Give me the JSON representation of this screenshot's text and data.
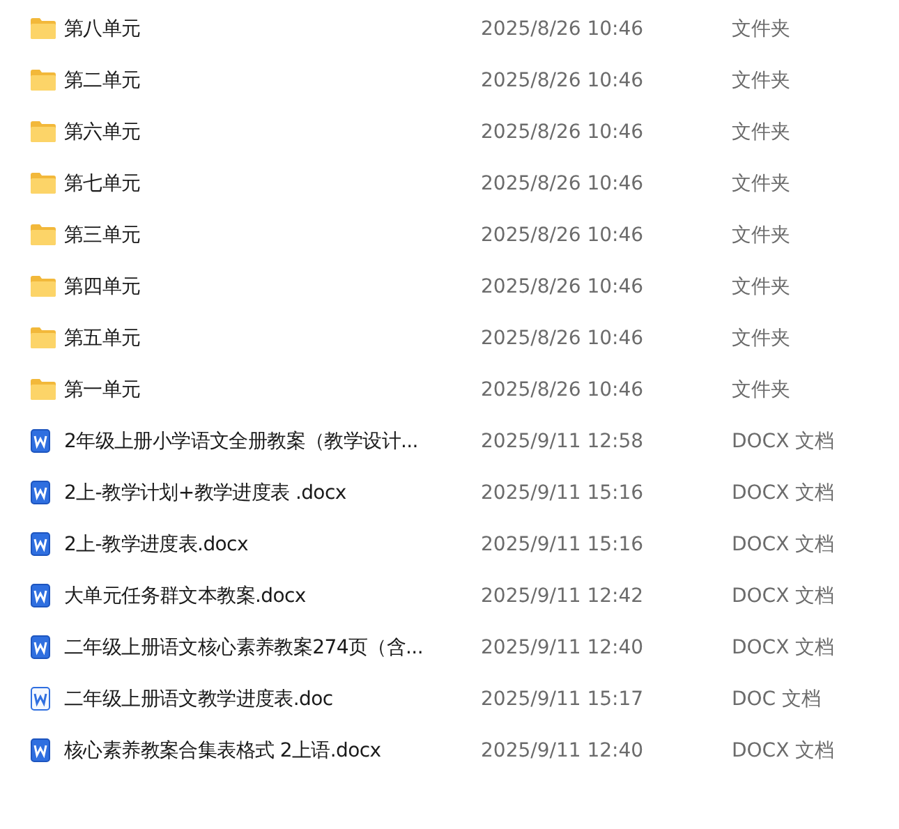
{
  "files": [
    {
      "kind": "folder",
      "name": "第八单元",
      "modified": "2025/8/26 10:46",
      "type": "文件夹"
    },
    {
      "kind": "folder",
      "name": "第二单元",
      "modified": "2025/8/26 10:46",
      "type": "文件夹"
    },
    {
      "kind": "folder",
      "name": "第六单元",
      "modified": "2025/8/26 10:46",
      "type": "文件夹"
    },
    {
      "kind": "folder",
      "name": "第七单元",
      "modified": "2025/8/26 10:46",
      "type": "文件夹"
    },
    {
      "kind": "folder",
      "name": "第三单元",
      "modified": "2025/8/26 10:46",
      "type": "文件夹"
    },
    {
      "kind": "folder",
      "name": "第四单元",
      "modified": "2025/8/26 10:46",
      "type": "文件夹"
    },
    {
      "kind": "folder",
      "name": "第五单元",
      "modified": "2025/8/26 10:46",
      "type": "文件夹"
    },
    {
      "kind": "folder",
      "name": "第一单元",
      "modified": "2025/8/26 10:46",
      "type": "文件夹"
    },
    {
      "kind": "docx",
      "name": "2年级上册小学语文全册教案（教学设计...",
      "modified": "2025/9/11 12:58",
      "type": "DOCX 文档"
    },
    {
      "kind": "docx",
      "name": "2上-教学计划+教学进度表 .docx",
      "modified": "2025/9/11 15:16",
      "type": "DOCX 文档"
    },
    {
      "kind": "docx",
      "name": "2上-教学进度表.docx",
      "modified": "2025/9/11 15:16",
      "type": "DOCX 文档"
    },
    {
      "kind": "docx",
      "name": "大单元任务群文本教案.docx",
      "modified": "2025/9/11 12:42",
      "type": "DOCX 文档"
    },
    {
      "kind": "docx",
      "name": "二年级上册语文核心素养教案274页（含...",
      "modified": "2025/9/11 12:40",
      "type": "DOCX 文档"
    },
    {
      "kind": "doc",
      "name": "二年级上册语文教学进度表.doc",
      "modified": "2025/9/11 15:17",
      "type": "DOC 文档"
    },
    {
      "kind": "docx",
      "name": "核心素养教案合集表格式 2上语.docx",
      "modified": "2025/9/11 12:40",
      "type": "DOCX 文档"
    }
  ]
}
